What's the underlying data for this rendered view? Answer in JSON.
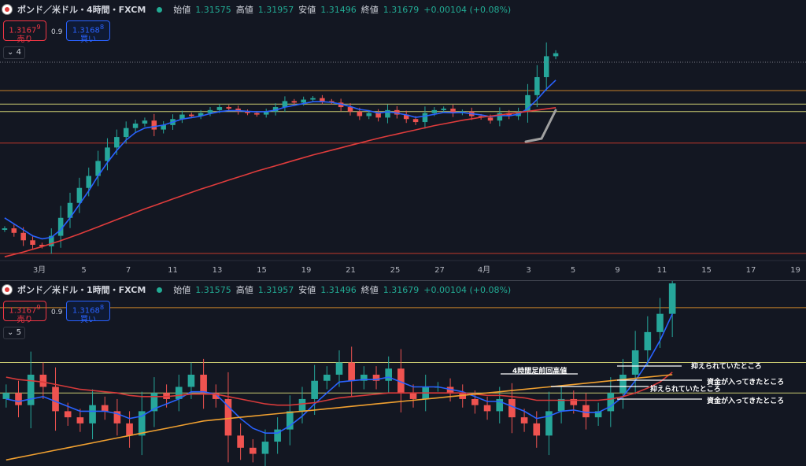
{
  "chart_data": [
    {
      "type": "candlestick",
      "title": "ポンド／米ドル・4時間・FXCM",
      "ohlc_legend": {
        "open_label": "始値",
        "open": "1.31575",
        "high_label": "高値",
        "high": "1.31957",
        "low_label": "安値",
        "low": "1.31496",
        "close_label": "終値",
        "close": "1.31679",
        "change": "+0.00104 (+0.08%)"
      },
      "sell": {
        "price": "1.3167",
        "sup": "9",
        "label": "売り"
      },
      "buy": {
        "price": "1.3168",
        "sup": "8",
        "label": "買い"
      },
      "spread": "0.9",
      "indicator_count": "4",
      "x_ticks": [
        "3月",
        "5",
        "7",
        "11",
        "13",
        "15",
        "19",
        "21",
        "25",
        "27",
        "4月",
        "3",
        "5",
        "9",
        "11",
        "15",
        "17",
        "19"
      ],
      "ylim": [
        1.255,
        1.326
      ],
      "horizontal_lines": [
        {
          "value": 1.3115,
          "color": "#c8822a"
        },
        {
          "value": 1.307,
          "color": "#c8c870"
        },
        {
          "value": 1.3045,
          "color": "#c8c870"
        },
        {
          "value": 1.294,
          "color": "#c0392b"
        },
        {
          "value": 1.2571,
          "color": "#c0392b"
        }
      ],
      "series": [
        {
          "name": "",
          "kind": "close",
          "values": [
            1.2655,
            1.264,
            1.2615,
            1.26,
            1.2595,
            1.263,
            1.269,
            1.274,
            1.279,
            1.283,
            1.288,
            1.2925,
            1.296,
            1.299,
            1.3005,
            1.3015,
            1.2985,
            1.3,
            1.302,
            1.3035,
            1.303,
            1.304,
            1.305,
            1.306,
            1.3055,
            1.3045,
            1.304,
            1.3035,
            1.3045,
            1.306,
            1.308,
            1.3075,
            1.3085,
            1.309,
            1.308,
            1.3075,
            1.306,
            1.3045,
            1.303,
            1.304,
            1.3025,
            1.305,
            1.3035,
            1.302,
            1.301,
            1.304,
            1.305,
            1.3055,
            1.304,
            1.3045,
            1.303,
            1.3025,
            1.3015,
            1.304,
            1.303,
            1.3045,
            1.31,
            1.316,
            1.323,
            1.324
          ]
        },
        {
          "name": "",
          "kind": "ema_fast",
          "color": "#2962ff",
          "values": [
            1.269,
            1.267,
            1.265,
            1.263,
            1.262,
            1.2625,
            1.265,
            1.269,
            1.2735,
            1.278,
            1.283,
            1.2875,
            1.2915,
            1.295,
            1.2975,
            1.299,
            1.2995,
            1.3,
            1.301,
            1.302,
            1.3025,
            1.303,
            1.3038,
            1.3045,
            1.3048,
            1.3048,
            1.3046,
            1.3044,
            1.3045,
            1.305,
            1.306,
            1.3066,
            1.3072,
            1.3078,
            1.3078,
            1.3076,
            1.307,
            1.3062,
            1.3052,
            1.3048,
            1.304,
            1.3044,
            1.304,
            1.3034,
            1.3026,
            1.303,
            1.3036,
            1.3042,
            1.3041,
            1.3042,
            1.3038,
            1.3034,
            1.3028,
            1.3032,
            1.3031,
            1.3036,
            1.3055,
            1.3085,
            1.312,
            1.315
          ]
        },
        {
          "name": "",
          "kind": "ema_slow",
          "color": "#e03c3c",
          "values": [
            1.256,
            1.2568,
            1.2576,
            1.2585,
            1.2594,
            1.2604,
            1.2614,
            1.2625,
            1.2636,
            1.2648,
            1.266,
            1.2672,
            1.2684,
            1.2696,
            1.2708,
            1.272,
            1.2731,
            1.2742,
            1.2753,
            1.2764,
            1.2775,
            1.2786,
            1.2796,
            1.2806,
            1.2816,
            1.2826,
            1.2836,
            1.2846,
            1.2855,
            1.2864,
            1.2873,
            1.2882,
            1.2891,
            1.29,
            1.2908,
            1.2916,
            1.2924,
            1.2932,
            1.294,
            1.2948,
            1.2956,
            1.2963,
            1.297,
            1.2977,
            1.2984,
            1.2991,
            1.2998,
            1.3004,
            1.301,
            1.3016,
            1.3021,
            1.3026,
            1.303,
            1.3034,
            1.3038,
            1.3042,
            1.3046,
            1.305,
            1.3054,
            1.3058
          ]
        }
      ]
    },
    {
      "type": "candlestick",
      "title": "ポンド／米ドル・1時間・FXCM",
      "ohlc_legend": {
        "open_label": "始値",
        "open": "1.31575",
        "high_label": "高値",
        "high": "1.31957",
        "low_label": "安値",
        "low": "1.31496",
        "close_label": "終値",
        "close": "1.31679",
        "change": "+0.00104 (+0.08%)"
      },
      "sell": {
        "price": "1.3167",
        "sup": "9",
        "label": "売り"
      },
      "buy": {
        "price": "1.3168",
        "sup": "8",
        "label": "買い"
      },
      "spread": "0.9",
      "indicator_count": "5",
      "ylim": [
        1.2985,
        1.3135
      ],
      "horizontal_lines": [
        {
          "value": 1.3115,
          "color": "#c8822a"
        },
        {
          "value": 1.307,
          "color": "#c8c870"
        },
        {
          "value": 1.3045,
          "color": "#c8c870"
        }
      ],
      "annotations": [
        "4時間足前回高値",
        "抑えられていたところ",
        "資金が入ってきたところ",
        "抑えられていたところ",
        "資金が入ってきたところ"
      ],
      "series": [
        {
          "name": "",
          "kind": "close",
          "values": [
            1.3045,
            1.3035,
            1.306,
            1.305,
            1.303,
            1.3025,
            1.302,
            1.3035,
            1.303,
            1.302,
            1.301,
            1.303,
            1.3045,
            1.304,
            1.305,
            1.306,
            1.3045,
            1.304,
            1.301,
            1.3,
            1.2995,
            1.3005,
            1.3015,
            1.303,
            1.304,
            1.3055,
            1.306,
            1.307,
            1.3055,
            1.306,
            1.3055,
            1.3065,
            1.3045,
            1.304,
            1.305,
            1.305,
            1.3045,
            1.304,
            1.3035,
            1.303,
            1.304,
            1.3025,
            1.302,
            1.301,
            1.303,
            1.304,
            1.3035,
            1.3025,
            1.303,
            1.3045,
            1.306,
            1.308,
            1.3095,
            1.311,
            1.3135
          ]
        },
        {
          "name": "",
          "kind": "ema_fast",
          "color": "#2962ff",
          "values": [
            1.304,
            1.3038,
            1.304,
            1.3042,
            1.3038,
            1.3034,
            1.303,
            1.303,
            1.303,
            1.3028,
            1.3024,
            1.3026,
            1.3032,
            1.3036,
            1.304,
            1.3046,
            1.3046,
            1.3044,
            1.3034,
            1.3024,
            1.3016,
            1.3012,
            1.3012,
            1.3018,
            1.3026,
            1.3036,
            1.3045,
            1.3054,
            1.3055,
            1.3056,
            1.3056,
            1.3058,
            1.3054,
            1.305,
            1.305,
            1.305,
            1.3048,
            1.3046,
            1.3042,
            1.3038,
            1.3038,
            1.3034,
            1.303,
            1.3024,
            1.3026,
            1.303,
            1.3031,
            1.3029,
            1.3029,
            1.3034,
            1.3042,
            1.3055,
            1.307,
            1.3088,
            1.311
          ]
        },
        {
          "name": "",
          "kind": "ema_mid",
          "color": "#d63a3a",
          "values": [
            1.3058,
            1.3056,
            1.3055,
            1.3054,
            1.3052,
            1.305,
            1.3048,
            1.3047,
            1.3046,
            1.3045,
            1.3043,
            1.3042,
            1.3042,
            1.3042,
            1.3043,
            1.3044,
            1.3044,
            1.3044,
            1.3042,
            1.304,
            1.3038,
            1.3036,
            1.3035,
            1.3035,
            1.3036,
            1.3037,
            1.3039,
            1.3041,
            1.3042,
            1.3043,
            1.3044,
            1.3045,
            1.3045,
            1.3045,
            1.3045,
            1.3045,
            1.3045,
            1.3045,
            1.3044,
            1.3043,
            1.3043,
            1.3042,
            1.3041,
            1.3039,
            1.3039,
            1.3039,
            1.3039,
            1.3039,
            1.3039,
            1.304,
            1.3042,
            1.3045,
            1.3049,
            1.3054,
            1.3062
          ]
        },
        {
          "name": "",
          "kind": "ema_slow",
          "color": "#f0a030",
          "values": [
            1.299,
            1.2992,
            1.2994,
            1.2996,
            1.2998,
            1.3,
            1.3002,
            1.3004,
            1.3006,
            1.3008,
            1.301,
            1.3012,
            1.3014,
            1.3016,
            1.3018,
            1.302,
            1.3022,
            1.3023,
            1.3024,
            1.3025,
            1.3026,
            1.3027,
            1.3028,
            1.3029,
            1.303,
            1.3031,
            1.3032,
            1.3033,
            1.3034,
            1.3035,
            1.3036,
            1.3037,
            1.3038,
            1.3039,
            1.304,
            1.3041,
            1.3042,
            1.3043,
            1.3044,
            1.3045,
            1.3046,
            1.3047,
            1.3048,
            1.3049,
            1.305,
            1.3051,
            1.3052,
            1.3053,
            1.3054,
            1.3055,
            1.3056,
            1.3057,
            1.3058,
            1.3059,
            1.306
          ]
        }
      ]
    }
  ]
}
